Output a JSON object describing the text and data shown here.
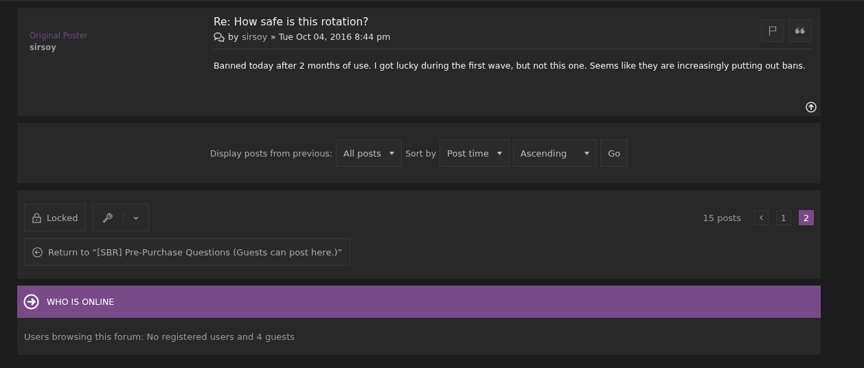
{
  "post": {
    "rank": "Original Poster",
    "username": "sirsoy",
    "title": "Re: How safe is this rotation?",
    "by": "by",
    "author": "sirsoy",
    "date": "» Tue Oct 04, 2016 8:44 pm",
    "body": "Banned today after 2 months of use. I got lucky during the first wave, but not this one. Seems like they are increasingly putting out bans."
  },
  "sort_bar": {
    "display_label": "Display posts from previous:",
    "display_value": "All posts",
    "sort_label": "Sort by",
    "sort_value": "Post time",
    "order_value": "Ascending",
    "go": "Go"
  },
  "actions": {
    "locked": "Locked",
    "return_link": "Return to “[SBR] Pre-Purchase Questions (Guests can post here.)”",
    "post_count": "15 posts",
    "pages": [
      {
        "label": "1",
        "selected": false
      },
      {
        "label": "2",
        "selected": true
      }
    ]
  },
  "who_is_online": {
    "title": "WHO IS ONLINE",
    "text": "Users browsing this forum: No registered users and 4 guests"
  }
}
